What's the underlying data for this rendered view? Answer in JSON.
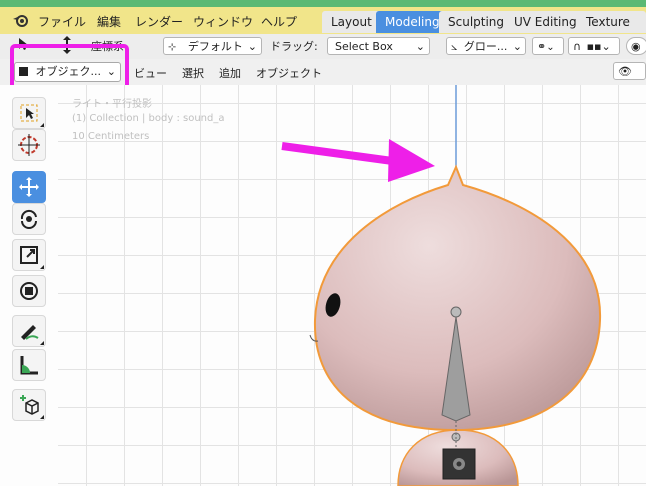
{
  "menubar": {
    "items": [
      "ファイル",
      "編集",
      "レンダー",
      "ウィンドウ",
      "ヘルプ"
    ]
  },
  "workspace_tabs": [
    "Layout",
    "Modeling",
    "Sculpting",
    "UV Editing",
    "Texture Pain"
  ],
  "active_tab": "Modeling",
  "toolbar": {
    "orientation_label": "座標系",
    "pivot_dropdown": "デフォルト",
    "drag_label": "ドラッグ:",
    "drag_dropdown": "Select Box",
    "transform_orientation": "グロー..."
  },
  "header": {
    "mode_dropdown": "オブジェク...",
    "menu_items": [
      "ビュー",
      "選択",
      "追加",
      "オブジェクト"
    ]
  },
  "viewport": {
    "view_name": "ライト・平行投影",
    "collection_info": "(1) Collection | body : sound_a",
    "scale_text": "10 Centimeters"
  },
  "colors": {
    "highlight": "#ee1fe8",
    "arrow": "#ee1fe8",
    "active_accent": "#4a8fe0",
    "menubar_bg": "#f1e58a",
    "object_outline": "#f29a3a",
    "body_color": "#e2c2c2"
  },
  "tools": [
    "select-box-icon",
    "cursor-icon",
    "move-icon",
    "rotate-icon",
    "scale-icon",
    "transform-icon",
    "annotate-icon",
    "measure-icon",
    "add-cube-icon"
  ]
}
